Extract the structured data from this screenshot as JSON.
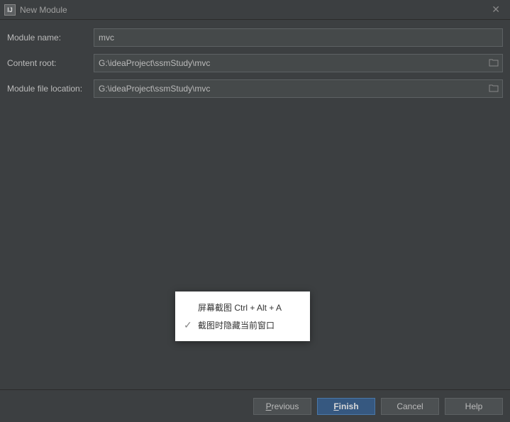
{
  "titlebar": {
    "icon_label": "IJ",
    "title": "New Module"
  },
  "form": {
    "module_name_label": "Module name:",
    "module_name_value": "mvc",
    "content_root_label": "Content root:",
    "content_root_value": "G:\\ideaProject\\ssmStudy\\mvc",
    "module_file_location_label": "Module file location:",
    "module_file_location_value": "G:\\ideaProject\\ssmStudy\\mvc"
  },
  "tooltip": {
    "line1": "屏幕截图 Ctrl + Alt + A",
    "line2": "截图时隐藏当前窗口"
  },
  "buttons": {
    "previous": "Previous",
    "finish": "Finish",
    "cancel": "Cancel",
    "help": "Help"
  }
}
